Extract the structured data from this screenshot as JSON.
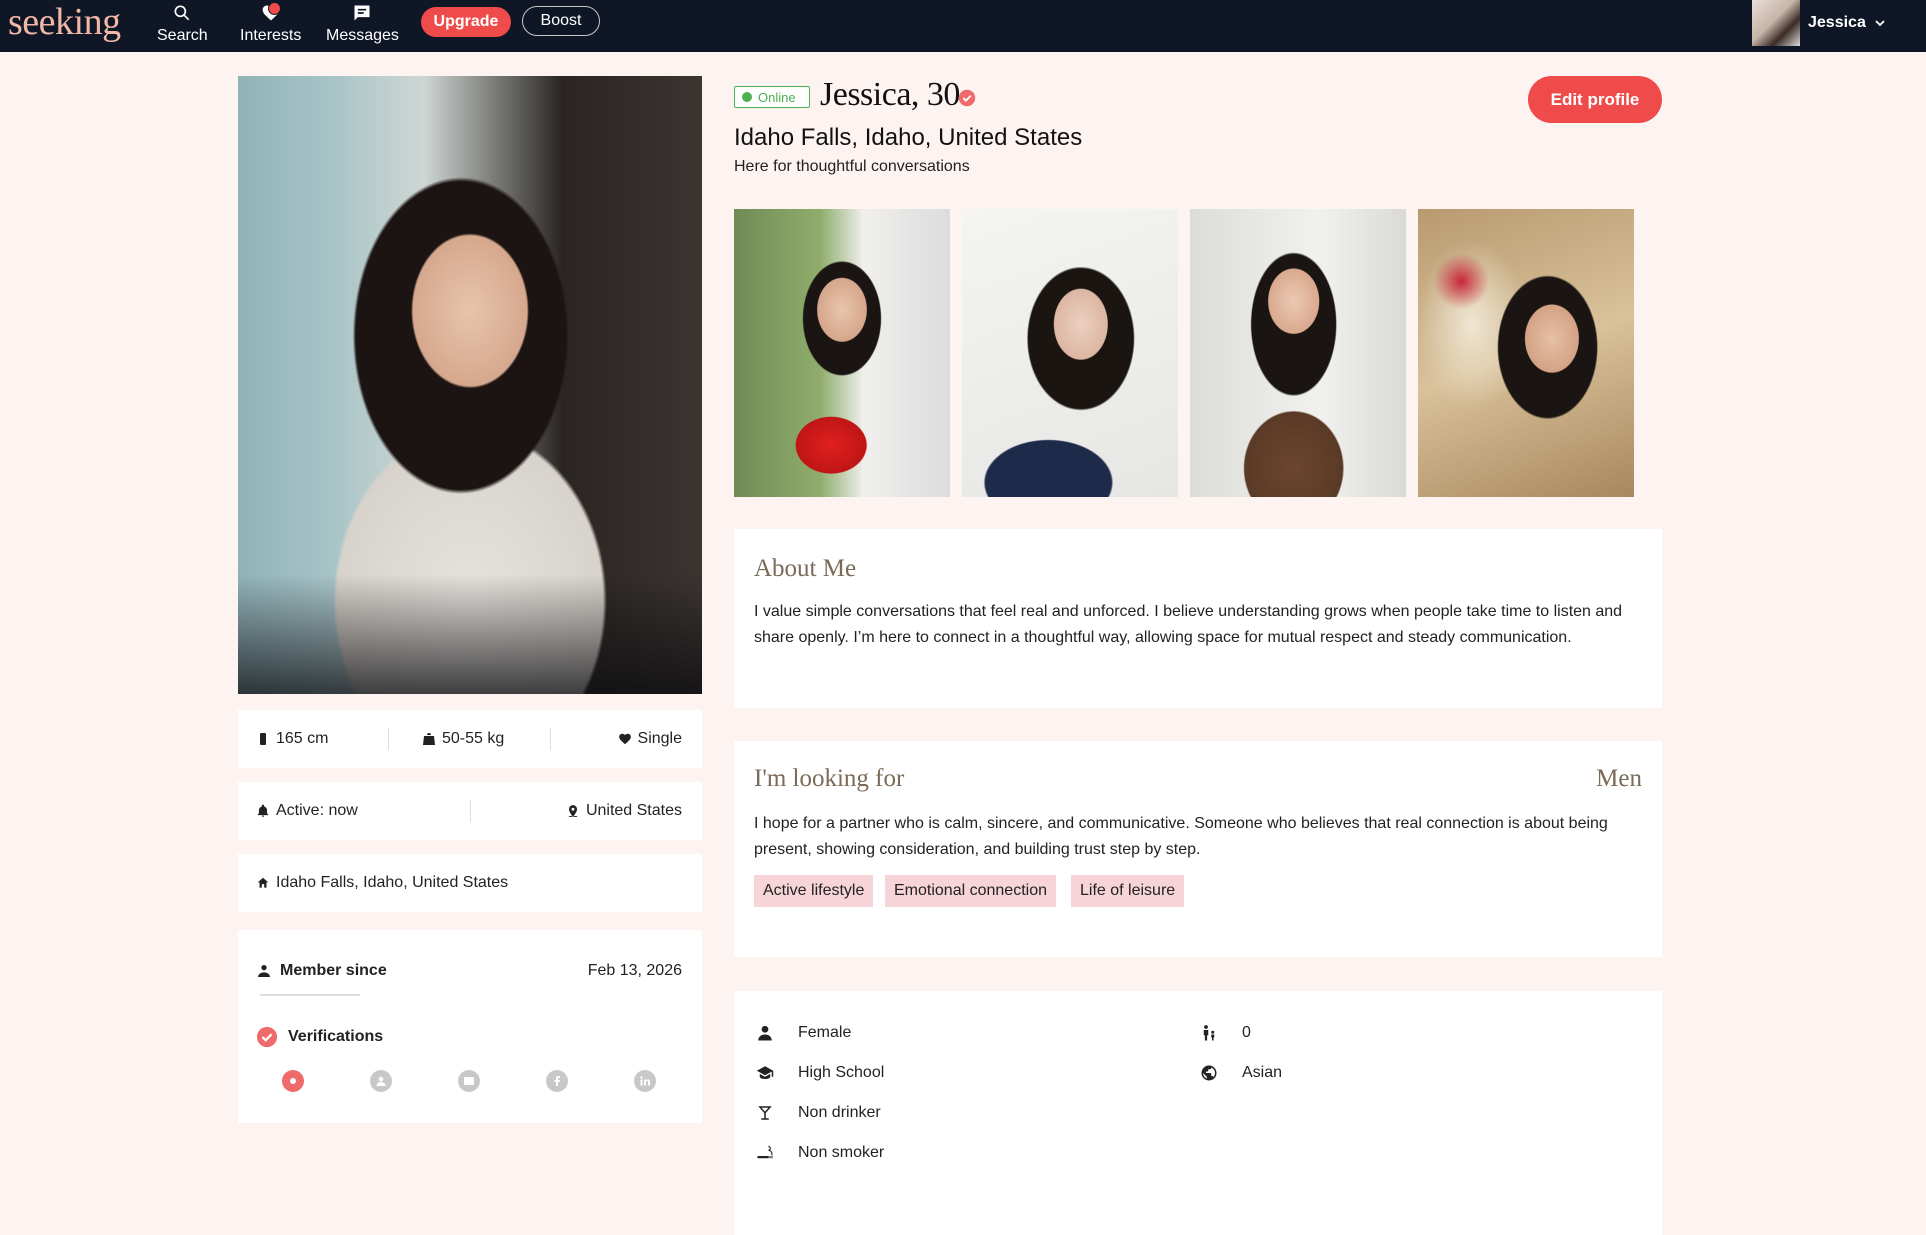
{
  "nav": {
    "logo": "seeking",
    "items": [
      {
        "label": "Search",
        "icon": "search-icon"
      },
      {
        "label": "Interests",
        "icon": "heart-icon",
        "badge": true
      },
      {
        "label": "Messages",
        "icon": "message-icon"
      }
    ],
    "upgrade_label": "Upgrade",
    "boost_label": "Boost",
    "user_name": "Jessica"
  },
  "profile": {
    "status": "Online",
    "name_age": "Jessica, 30",
    "location": "Idaho Falls, Idaho, United States",
    "tagline": "Here for thoughtful conversations",
    "edit_label": "Edit profile"
  },
  "stats": {
    "height": "165 cm",
    "weight": "50-55 kg",
    "relationship": "Single",
    "active": "Active: now",
    "country": "United States",
    "hometown": "Idaho Falls, Idaho, United States",
    "member_since_label": "Member since",
    "member_since_date": "Feb 13, 2026",
    "verifications_label": "Verifications"
  },
  "about": {
    "heading": "About Me",
    "text": "I value simple conversations that feel real and unforced. I believe understanding grows when people take time to listen and share openly. I’m here to connect in a thoughtful way, allowing space for mutual respect and steady communication."
  },
  "looking": {
    "heading": "I'm looking for",
    "target": "Men",
    "text": "I hope for a partner who is calm, sincere, and communicative. Someone who believes that real connection is about being present, showing consideration, and building trust step by step.",
    "tags": [
      "Active lifestyle",
      "Emotional connection",
      "Life of leisure"
    ]
  },
  "details": {
    "gender": "Female",
    "education": "High School",
    "drinking": "Non drinker",
    "smoking": "Non smoker",
    "children": "0",
    "ethnicity": "Asian"
  },
  "colors": {
    "accent": "#ef4b4b",
    "nav_bg": "#0f1626",
    "page_bg": "#fdf3f1",
    "online": "#4cb050",
    "tag_bg": "#f7d4d8",
    "heading": "#7a6a58"
  }
}
